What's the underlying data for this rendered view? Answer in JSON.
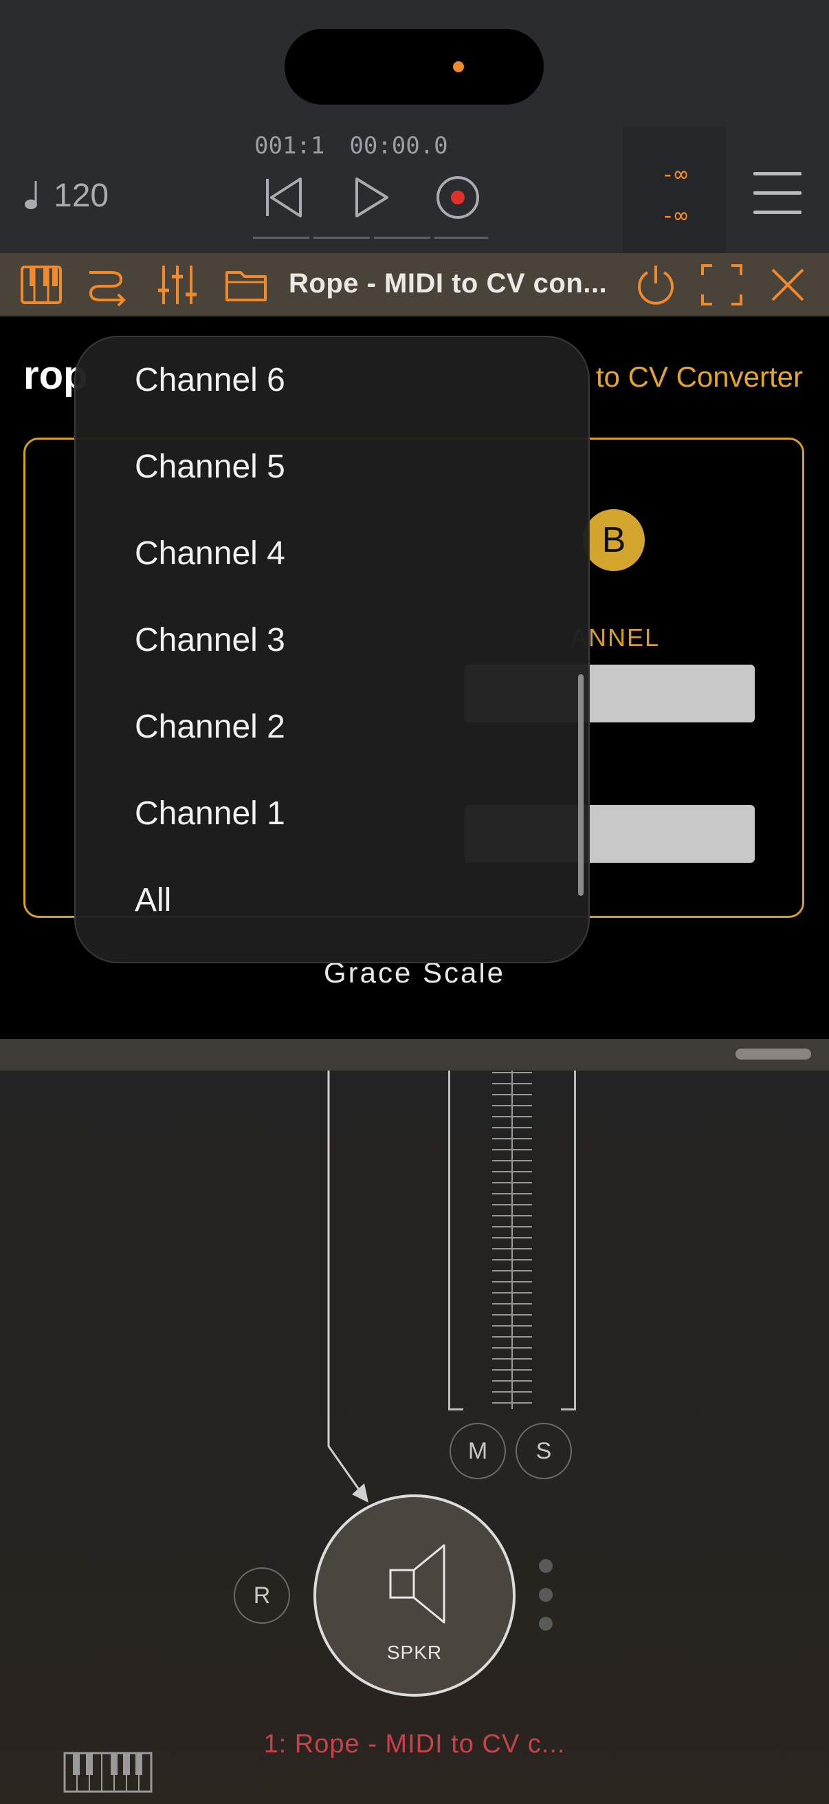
{
  "host": {
    "tempo": "120",
    "position_bars": "001:1",
    "position_time": "00:00.0",
    "meter_top": "-∞",
    "meter_bottom": "-∞"
  },
  "plugin_bar": {
    "title": "Rope - MIDI to CV con..."
  },
  "plugin": {
    "name": "rop",
    "subtitle": "to CV Converter",
    "badge": "B",
    "channel_label": "ANNEL",
    "brand": "Grace Scale"
  },
  "dropdown": {
    "items": [
      "Channel 6",
      "Channel 5",
      "Channel 4",
      "Channel 3",
      "Channel 2",
      "Channel 1",
      "All"
    ]
  },
  "mixer": {
    "mute_label": "M",
    "solo_label": "S",
    "record_label": "R",
    "output_label": "SPKR",
    "track_name": "1: Rope - MIDI to CV c..."
  },
  "colors": {
    "accent_orange": "#f08a2a",
    "accent_gold": "#d99e28",
    "track_red": "#c8424c",
    "toolbar_bg": "#4a4339"
  }
}
